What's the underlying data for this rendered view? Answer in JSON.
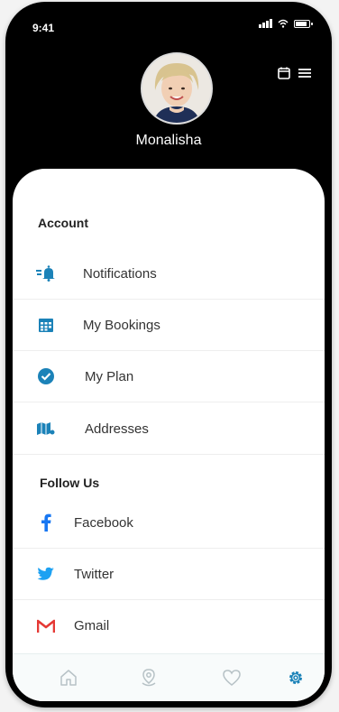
{
  "status": {
    "time": "9:41"
  },
  "profile": {
    "name": "Monalisha"
  },
  "account": {
    "title": "Account",
    "items": [
      {
        "label": "Notifications",
        "icon": "notification-bell-icon"
      },
      {
        "label": "My Bookings",
        "icon": "calendar-icon"
      },
      {
        "label": "My Plan",
        "icon": "check-circle-icon"
      },
      {
        "label": "Addresses",
        "icon": "map-icon"
      }
    ]
  },
  "follow": {
    "title": "Follow Us",
    "items": [
      {
        "label": "Facebook",
        "icon": "facebook-icon"
      },
      {
        "label": "Twitter",
        "icon": "twitter-icon"
      },
      {
        "label": "Gmail",
        "icon": "gmail-icon"
      }
    ]
  },
  "colors": {
    "accent": "#1b82b8",
    "facebook": "#1877f2",
    "twitter": "#1da1f2",
    "gmail": "#e53935",
    "nav_inactive": "#b7c2c6"
  },
  "nav": [
    {
      "icon": "home-icon"
    },
    {
      "icon": "location-pin-icon"
    },
    {
      "icon": "heart-icon"
    },
    {
      "icon": "settings-gear-icon",
      "active": true
    }
  ]
}
